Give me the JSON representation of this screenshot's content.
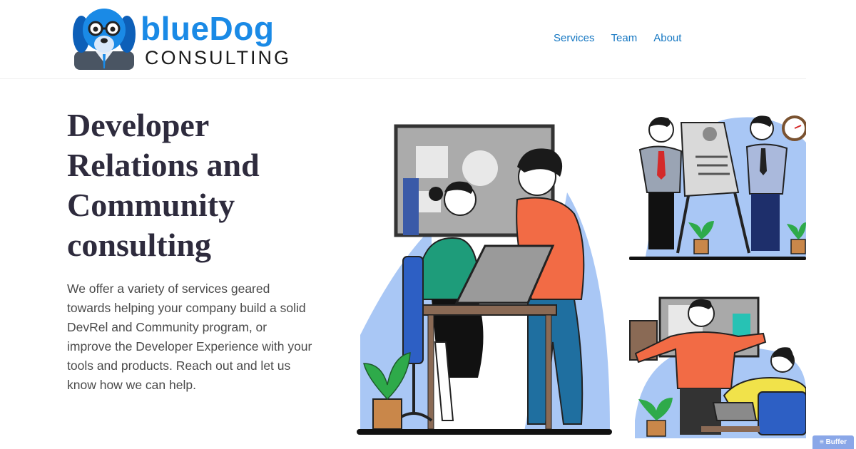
{
  "header": {
    "logo": {
      "brand_blue": "blueDog",
      "brand_dark": "CONSULTING",
      "icon": "dog-with-glasses-logo-icon"
    },
    "nav": [
      {
        "label": "Services"
      },
      {
        "label": "Team"
      },
      {
        "label": "About"
      }
    ]
  },
  "hero": {
    "title": "Developer Relations and Community consulting",
    "body": "We offer a variety of services geared towards helping your company build a solid DevRel and Community program, or improve the Developer Experience with your tools and products. Reach out and let us know how we can help."
  },
  "illustrations": [
    {
      "icon": "team-at-laptop-illustration-icon"
    },
    {
      "icon": "presentation-board-illustration-icon"
    },
    {
      "icon": "whiteboard-meeting-illustration-icon"
    }
  ],
  "buffer_badge": {
    "label": "Buffer",
    "icon": "buffer-stack-icon"
  },
  "colors": {
    "brand_blue": "#1a8ae6",
    "nav_link": "#1577c2",
    "title": "#2e2b3d",
    "body_text": "#4a4a4a",
    "illustration_blue": "#a9c7f5",
    "illustration_orange": "#f26b45"
  }
}
